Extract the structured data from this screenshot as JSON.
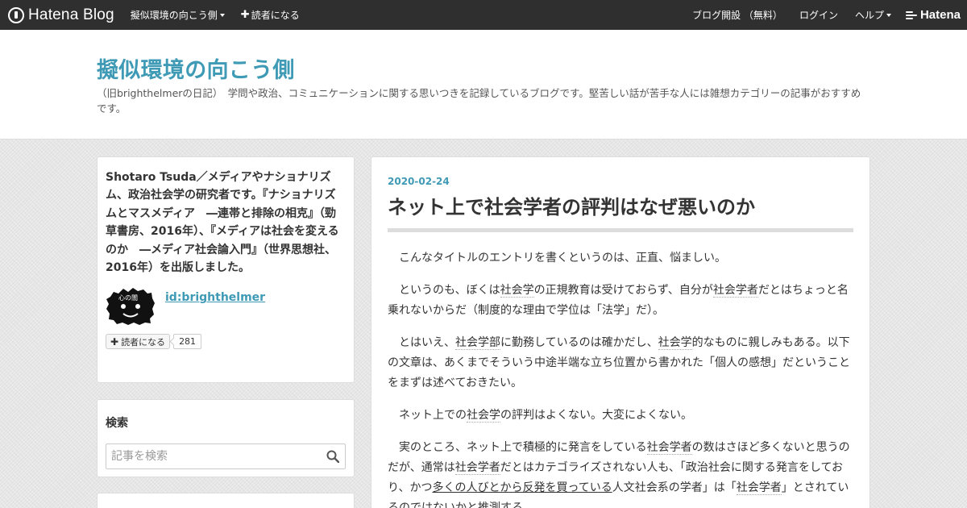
{
  "topbar": {
    "logo_text": "Hatena Blog",
    "blog_menu_label": "擬似環境の向こう側",
    "subscribe_label": "読者になる",
    "create_blog_label": "ブログ開設 （無料）",
    "login_label": "ログイン",
    "help_label": "ヘルプ",
    "hatena_label": "Hatena"
  },
  "header": {
    "title": "擬似環境の向こう側",
    "description": "（旧brighthelmerの日記）　学問や政治、コミュニケーションに関する思いつきを記録しているブログです。堅苦しい話が苦手な人には雑想カテゴリーの記事がおすすめです。"
  },
  "profile": {
    "text": "Shotaro Tsuda／メディアやナショナリズム、政治社会学の研究者です。『ナショナリズムとマスメディア　―連帯と排除の相克』（勁草書房、2016年）、『メディアは社会を変えるのか　―メディア社会論入門』（世界思想社、2016年）を出版しました。",
    "id": "id:brighthelmer",
    "subscribe_label": "読者になる",
    "subscriber_count": "281"
  },
  "search": {
    "title": "検索",
    "placeholder": "記事を検索"
  },
  "article": {
    "date": "2020-02-24",
    "title": "ネット上で社会学者の評判はなぜ悪いのか",
    "p1": "こんなタイトルのエントリを書くというのは、正直、悩ましい。",
    "p2_a": "というのも、ぼくは",
    "p2_kw1": "社会学",
    "p2_b": "の正規教育は受けておらず、自分が",
    "p2_kw2": "社会学者",
    "p2_c": "だとはちょっと名乗れないからだ（制度的な理由で学位は「法学」だ）。",
    "p3_a": "とはいえ、",
    "p3_kw1": "社会学部",
    "p3_b": "に勤務しているのは確かだし、",
    "p3_kw2": "社会学",
    "p3_c": "的なものに親しみもある。以下の文章は、あくまでそういう中途半端な立ち位置から書かれた「個人の感想」だということをまずは述べておきたい。",
    "p4_a": "ネット上での",
    "p4_kw1": "社会学",
    "p4_b": "の評判はよくない。大変によくない。",
    "p5_a": "実のところ、ネット上で積極的に発言をしている",
    "p5_kw1": "社会学者",
    "p5_b": "の数はさほど多くないと思うのだが、通常は",
    "p5_kw2": "社会学者",
    "p5_c": "だとはカテゴライズされない人も、「政治社会に関する発言をしており、かつ",
    "p5_ul": "多くの人びとから反発を買っている",
    "p5_d": "人文社会系の学者」は「",
    "p5_kw3": "社会学者",
    "p5_e": "」とされているのではないかと推測する。"
  }
}
